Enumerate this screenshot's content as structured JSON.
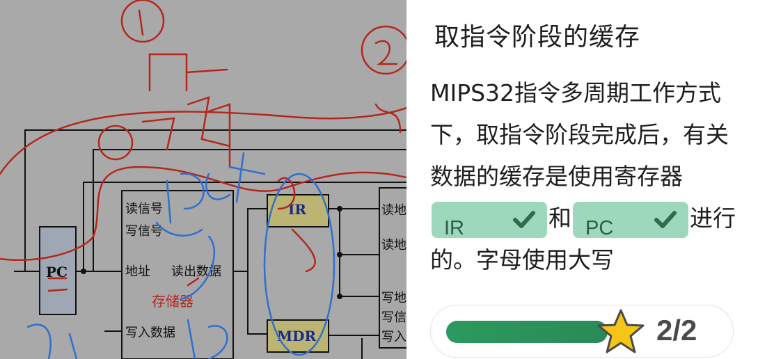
{
  "board": {
    "labels": {
      "pc": "PC",
      "read_signal": "读信号",
      "write_signal": "写信号",
      "address": "地址",
      "read_data": "读出数据",
      "memory": "存储器",
      "write_data": "写入数据",
      "ir": "IR",
      "mdr": "MDR",
      "reg_read_addr": "读地",
      "reg_read_addr2": "读地",
      "reg_write_addr": "写地",
      "reg_write_sig": "写信",
      "reg_write_in": "写入"
    }
  },
  "panel": {
    "title": "取指令阶段的缓存",
    "question_part1": "MIPS32指令多周期工作方式下，取指令阶段完成后，有关数据的缓存是使用寄存器",
    "blank1_answer": "IR",
    "connector": "和",
    "blank2_answer": "PC",
    "question_part2": "进行的。字母使用大写",
    "progress": {
      "value": 1.0,
      "count_text": "2/2"
    },
    "colors": {
      "blank_bg": "#9dd8bc",
      "check": "#2f6b4c",
      "progress": "#2c8f5a",
      "star": "#f5c518"
    }
  }
}
